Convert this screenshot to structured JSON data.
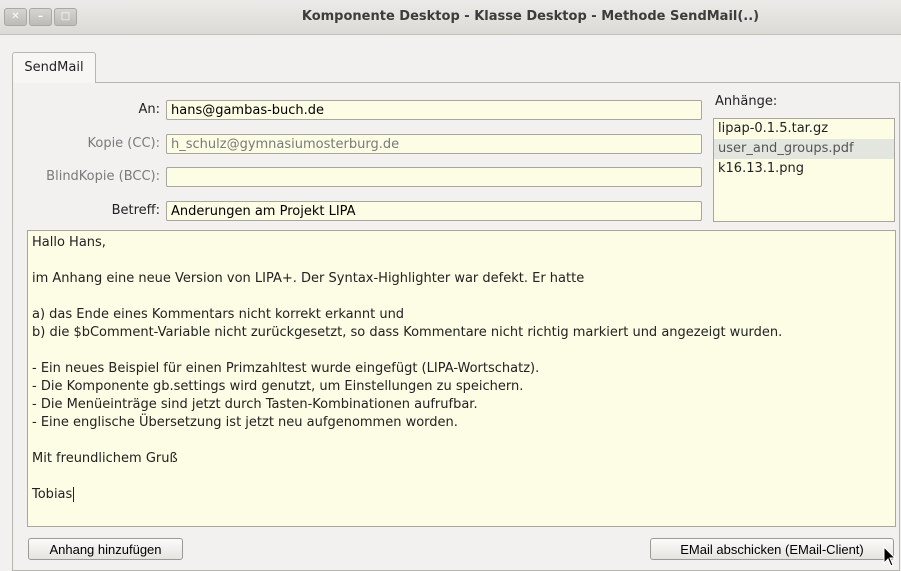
{
  "window": {
    "title": "Komponente Desktop - Klasse Desktop - Methode SendMail(..)",
    "controls": [
      "close-icon",
      "minimize-icon",
      "maximize-icon"
    ]
  },
  "tabs": [
    {
      "label": "SendMail"
    }
  ],
  "form": {
    "to_label": "An:",
    "to_value": "hans@gambas-buch.de",
    "cc_label": "Kopie (CC):",
    "cc_value": "h_schulz@gymnasiumosterburg.de",
    "bcc_label": "BlindKopie (BCC):",
    "bcc_value": "",
    "subject_label": "Betreff:",
    "subject_value": "Änderungen am Projekt LIPA"
  },
  "attachments": {
    "label": "Anhänge:",
    "items": [
      "lipap-0.1.5.tar.gz",
      "user_and_groups.pdf",
      "k16.13.1.png"
    ],
    "selected_index": 1
  },
  "message": {
    "lines": [
      "Hallo Hans,",
      "",
      "im Anhang eine neue Version von LIPA+. Der Syntax-Highlighter war defekt. Er hatte",
      "",
      "a) das Ende eines Kommentars nicht korrekt erkannt und",
      "b) die $bComment-Variable nicht zurückgesetzt, so dass Kommentare nicht richtig markiert und angezeigt wurden.",
      "",
      "- Ein neues Beispiel für einen Primzahltest wurde eingefügt (LIPA-Wortschatz).",
      "- Die Komponente gb.settings wird genutzt, um Einstellungen zu speichern.",
      "- Die Menüeinträge sind jetzt durch Tasten-Kombinationen aufrufbar.",
      "- Eine englische Übersetzung ist jetzt neu aufgenommen worden.",
      "",
      "Mit freundlichem Gruß",
      "",
      "Tobias"
    ]
  },
  "buttons": {
    "add_attachment": "Anhang hinzufügen",
    "send": "EMail abschicken (EMail-Client)"
  },
  "colors": {
    "field_bg": "#fdfce4",
    "window_bg": "#f2f1f0",
    "selected_item_bg": "#e2e6df"
  }
}
